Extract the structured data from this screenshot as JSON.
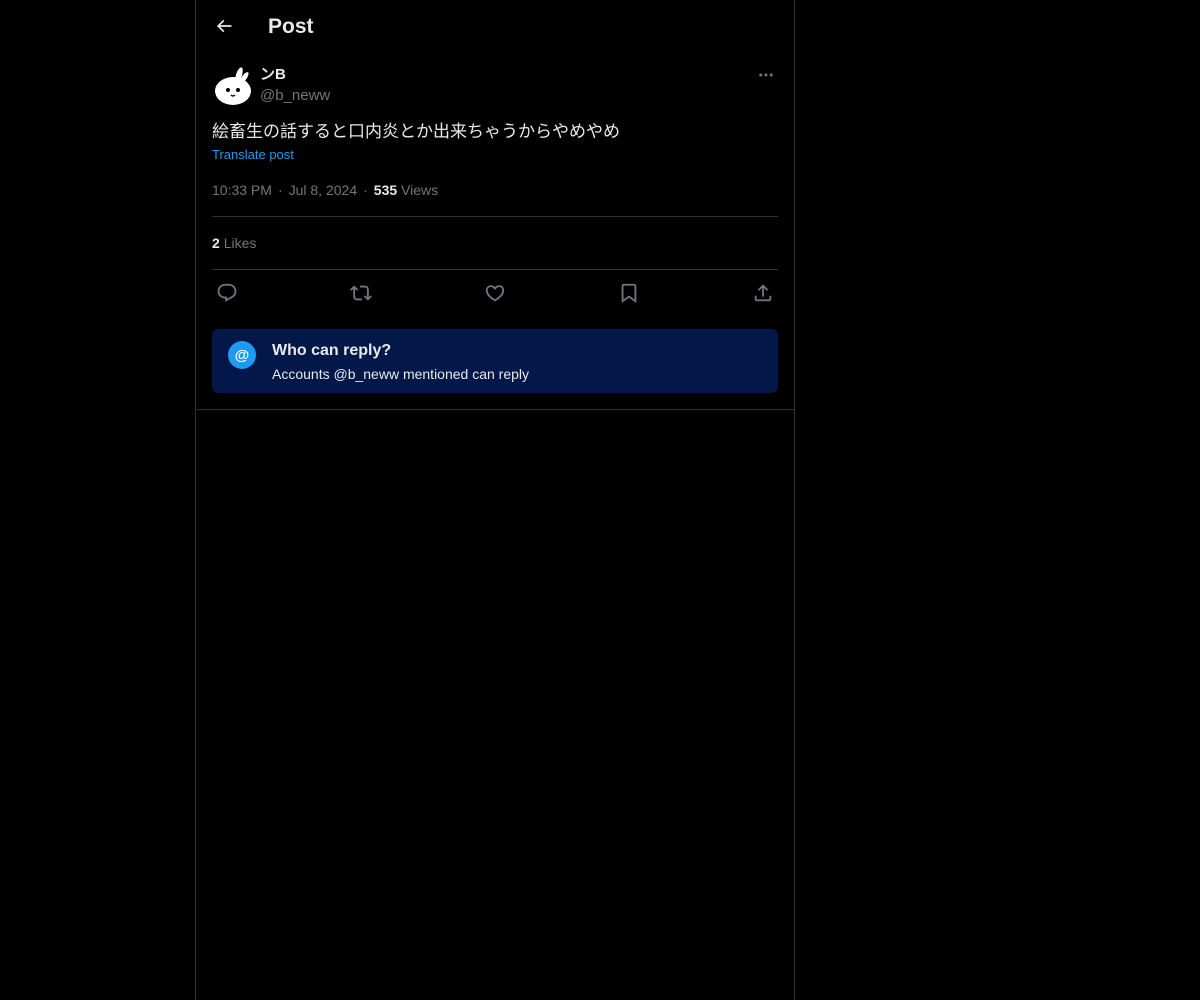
{
  "header": {
    "title": "Post"
  },
  "post": {
    "author": {
      "display_name": "ンB",
      "handle": "@b_neww"
    },
    "text": "絵畜生の話すると口内炎とか出来ちゃうからやめやめ",
    "translate_label": "Translate post",
    "time": "10:33 PM",
    "separator": "·",
    "date": "Jul 8, 2024",
    "views_count": "535",
    "views_label": "Views",
    "likes_count": "2",
    "likes_label": "Likes"
  },
  "reply_restriction": {
    "title": "Who can reply?",
    "subtitle": "Accounts @b_neww mentioned can reply",
    "icon_glyph": "@"
  },
  "icons": {
    "back": "arrow-left-icon",
    "more": "more-horizontal-icon",
    "reply": "reply-bubble-icon",
    "repost": "repost-icon",
    "like": "heart-icon",
    "bookmark": "bookmark-icon",
    "share": "share-upload-icon",
    "mention": "at-sign-icon"
  },
  "colors": {
    "background": "#000000",
    "text": "#e7e9ea",
    "secondary_text": "#71767b",
    "accent": "#1d9bf0",
    "divider": "#2f3336",
    "notice_background": "#031848"
  }
}
